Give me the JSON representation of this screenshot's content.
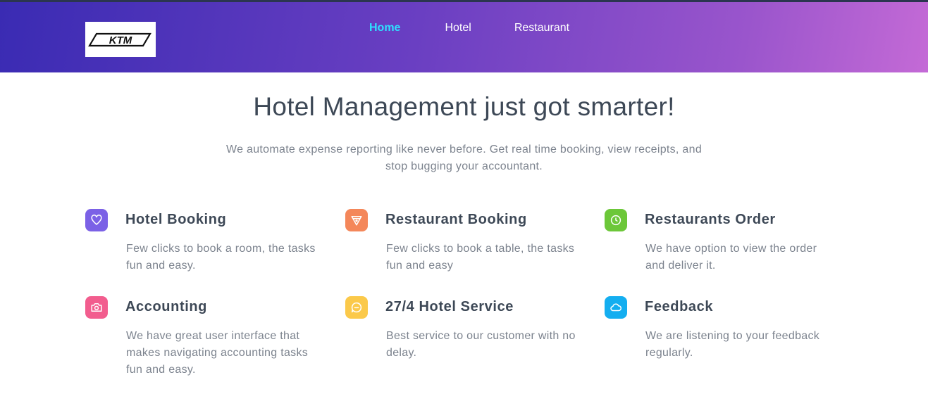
{
  "header": {
    "logo_text": "KTM",
    "nav": [
      {
        "label": "Home",
        "active": true
      },
      {
        "label": "Hotel",
        "active": false
      },
      {
        "label": "Restaurant",
        "active": false
      }
    ]
  },
  "hero": {
    "title": "Hotel Management just got smarter!",
    "subtitle": "We automate expense reporting like never before. Get real time booking, view receipts, and stop bugging your accountant."
  },
  "features": [
    {
      "title": "Hotel Booking",
      "desc": "Few clicks to book a room, the tasks fun and easy.",
      "icon": "heart-icon",
      "color": "#7b61e6"
    },
    {
      "title": "Restaurant Booking",
      "desc": "Few clicks to book a table, the tasks fun and easy",
      "icon": "pizza-icon",
      "color": "#f4875a"
    },
    {
      "title": "Restaurants Order",
      "desc": "We have option to view the order and deliver it.",
      "icon": "clock-icon",
      "color": "#6cc739"
    },
    {
      "title": "Accounting",
      "desc": "We have great user interface that makes navigating accounting tasks fun and easy.",
      "icon": "camera-icon",
      "color": "#f25d8e"
    },
    {
      "title": "27/4 Hotel Service",
      "desc": "Best service to our customer with no delay.",
      "icon": "chat-bubble-icon",
      "color": "#fbc94a"
    },
    {
      "title": "Feedback",
      "desc": "We are listening to your feedback regularly.",
      "icon": "cloud-icon",
      "color": "#14aef0"
    }
  ]
}
